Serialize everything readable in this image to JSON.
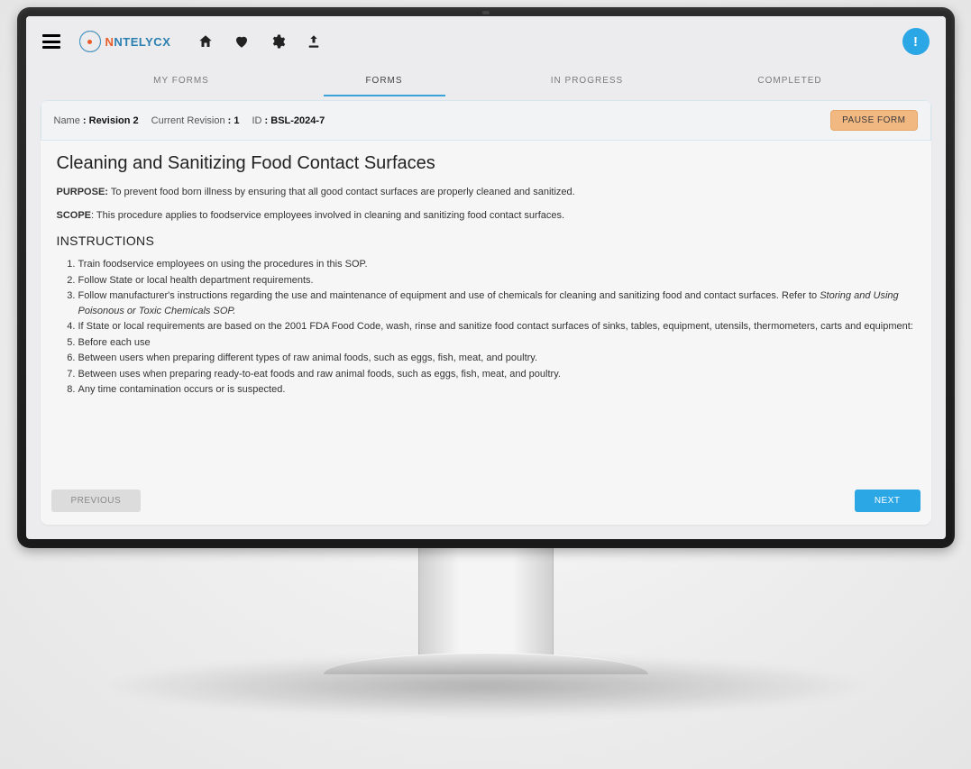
{
  "brand": {
    "name": "NTELYCX"
  },
  "topbar": {
    "alert_glyph": "!"
  },
  "tabs": [
    {
      "label": "MY FORMS",
      "active": false
    },
    {
      "label": "FORMS",
      "active": true
    },
    {
      "label": "IN PROGRESS",
      "active": false
    },
    {
      "label": "COMPLETED",
      "active": false
    }
  ],
  "form_meta": {
    "name_label": "Name",
    "name_value": ": Revision 2",
    "rev_label": "Current Revision",
    "rev_value": ": 1",
    "id_label": "ID",
    "id_value": ": BSL-2024-7",
    "pause_label": "PAUSE FORM"
  },
  "content": {
    "title": "Cleaning and Sanitizing Food Contact Surfaces",
    "purpose_label": "PURPOSE:",
    "purpose_text": " To prevent food born illness by ensuring that all good contact surfaces are properly cleaned and sanitized.",
    "scope_label": "SCOPE",
    "scope_text": ": This procedure applies to foodservice employees involved in cleaning and sanitizing food contact surfaces.",
    "instructions_heading": "INSTRUCTIONS",
    "instructions": [
      {
        "text": "Train foodservice employees on using the procedures in this SOP."
      },
      {
        "text": "Follow State or local health department requirements."
      },
      {
        "text_pre": "Follow manufacturer's instructions regarding the use and maintenance of equipment and use of chemicals for cleaning and sanitizing food and contact surfaces. Refer to ",
        "italic": "Storing and Using Poisonous or Toxic Chemicals SOP."
      },
      {
        "text": "If State or local requirements are based on the 2001 FDA Food Code, wash, rinse and sanitize food contact surfaces of sinks, tables, equipment, utensils, thermometers, carts and equipment:"
      },
      {
        "text": "Before each use"
      },
      {
        "text": "Between users when preparing different types of raw animal foods, such as eggs, fish, meat, and poultry."
      },
      {
        "text": "Between uses when preparing ready-to-eat foods and raw animal foods, such as eggs, fish, meat, and poultry."
      },
      {
        "text": "Any time contamination occurs or is suspected."
      }
    ]
  },
  "footer": {
    "prev_label": "PREVIOUS",
    "next_label": "NEXT"
  },
  "colors": {
    "accent": "#2aa7e4",
    "pause": "#f2b882"
  }
}
